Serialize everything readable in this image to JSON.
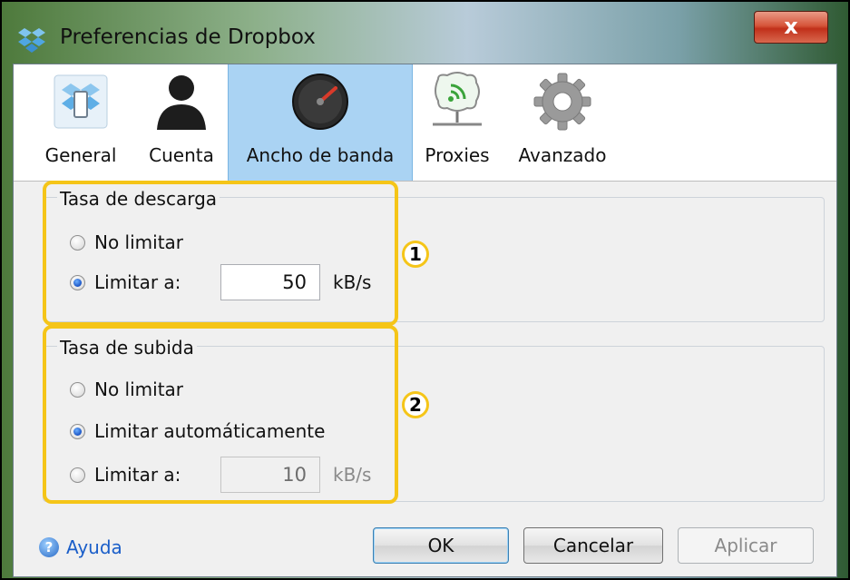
{
  "window": {
    "title": "Preferencias de Dropbox",
    "close_label": "x"
  },
  "tabs": [
    {
      "label": "General",
      "icon": "dropbox-box-icon"
    },
    {
      "label": "Cuenta",
      "icon": "user-silhouette-icon"
    },
    {
      "label": "Ancho de banda",
      "icon": "speedometer-icon"
    },
    {
      "label": "Proxies",
      "icon": "network-proxy-icon"
    },
    {
      "label": "Avanzado",
      "icon": "gear-icon"
    }
  ],
  "active_tab": "Ancho de banda",
  "download": {
    "group_title": "Tasa de descarga",
    "option_unlimited": "No limitar",
    "option_limit": "Limitar a:",
    "selected": "Limitar a:",
    "value": "50",
    "unit": "kB/s",
    "callout": "1"
  },
  "upload": {
    "group_title": "Tasa de subida",
    "option_unlimited": "No limitar",
    "option_auto": "Limitar automáticamente",
    "option_limit": "Limitar a:",
    "selected": "Limitar automáticamente",
    "value": "10",
    "unit": "kB/s",
    "callout": "2"
  },
  "footer": {
    "help_label": "Ayuda",
    "ok_label": "OK",
    "cancel_label": "Cancelar",
    "apply_label": "Aplicar"
  },
  "colors": {
    "highlight": "#f5c518",
    "active_tab": "#aad3f3",
    "link": "#1a5ec9"
  }
}
